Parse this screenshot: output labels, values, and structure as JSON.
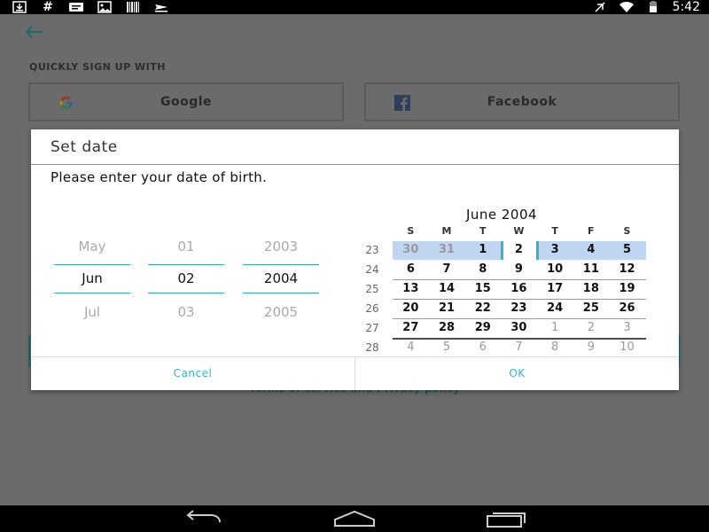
{
  "status_bar": {
    "time": "5:42",
    "left_icons": [
      "download-icon",
      "hash-icon",
      "message-icon",
      "image-icon",
      "barcode-icon",
      "plane-icon"
    ],
    "right_icons": [
      "no-sim-icon",
      "wifi-icon",
      "battery-icon"
    ]
  },
  "app": {
    "quick_sign_up_label": "QUICKLY SIGN UP WITH",
    "google_label": "Google",
    "facebook_label": "Facebook",
    "terms_text": "Terms of service and Privacy policy"
  },
  "dialog": {
    "title": "Set date",
    "message": "Please enter your date of birth.",
    "spinners": {
      "month": {
        "prev": "May",
        "current": "Jun",
        "next": "Jul"
      },
      "day": {
        "prev": "01",
        "current": "02",
        "next": "03"
      },
      "year": {
        "prev": "2003",
        "current": "2004",
        "next": "2005"
      }
    },
    "calendar": {
      "month_title": "June 2004",
      "day_headers": [
        "S",
        "M",
        "T",
        "W",
        "T",
        "F",
        "S"
      ],
      "weeks": [
        {
          "week": "23",
          "days": [
            "30",
            "31",
            "1",
            "2",
            "3",
            "4",
            "5"
          ]
        },
        {
          "week": "24",
          "days": [
            "6",
            "7",
            "8",
            "9",
            "10",
            "11",
            "12"
          ]
        },
        {
          "week": "25",
          "days": [
            "13",
            "14",
            "15",
            "16",
            "17",
            "18",
            "19"
          ]
        },
        {
          "week": "26",
          "days": [
            "20",
            "21",
            "22",
            "23",
            "24",
            "25",
            "26"
          ]
        },
        {
          "week": "27",
          "days": [
            "27",
            "28",
            "29",
            "30",
            "1",
            "2",
            "3"
          ]
        },
        {
          "week": "28",
          "days": [
            "4",
            "5",
            "6",
            "7",
            "8",
            "9",
            "10"
          ]
        }
      ]
    },
    "cancel_label": "Cancel",
    "ok_label": "OK"
  },
  "colors": {
    "accent": "#33b5c9",
    "selected_week": "#bfd5f2",
    "dim_background": "#6b6b6b"
  },
  "nav_bar": {
    "icons": [
      "back-icon",
      "home-icon",
      "recents-icon"
    ]
  }
}
